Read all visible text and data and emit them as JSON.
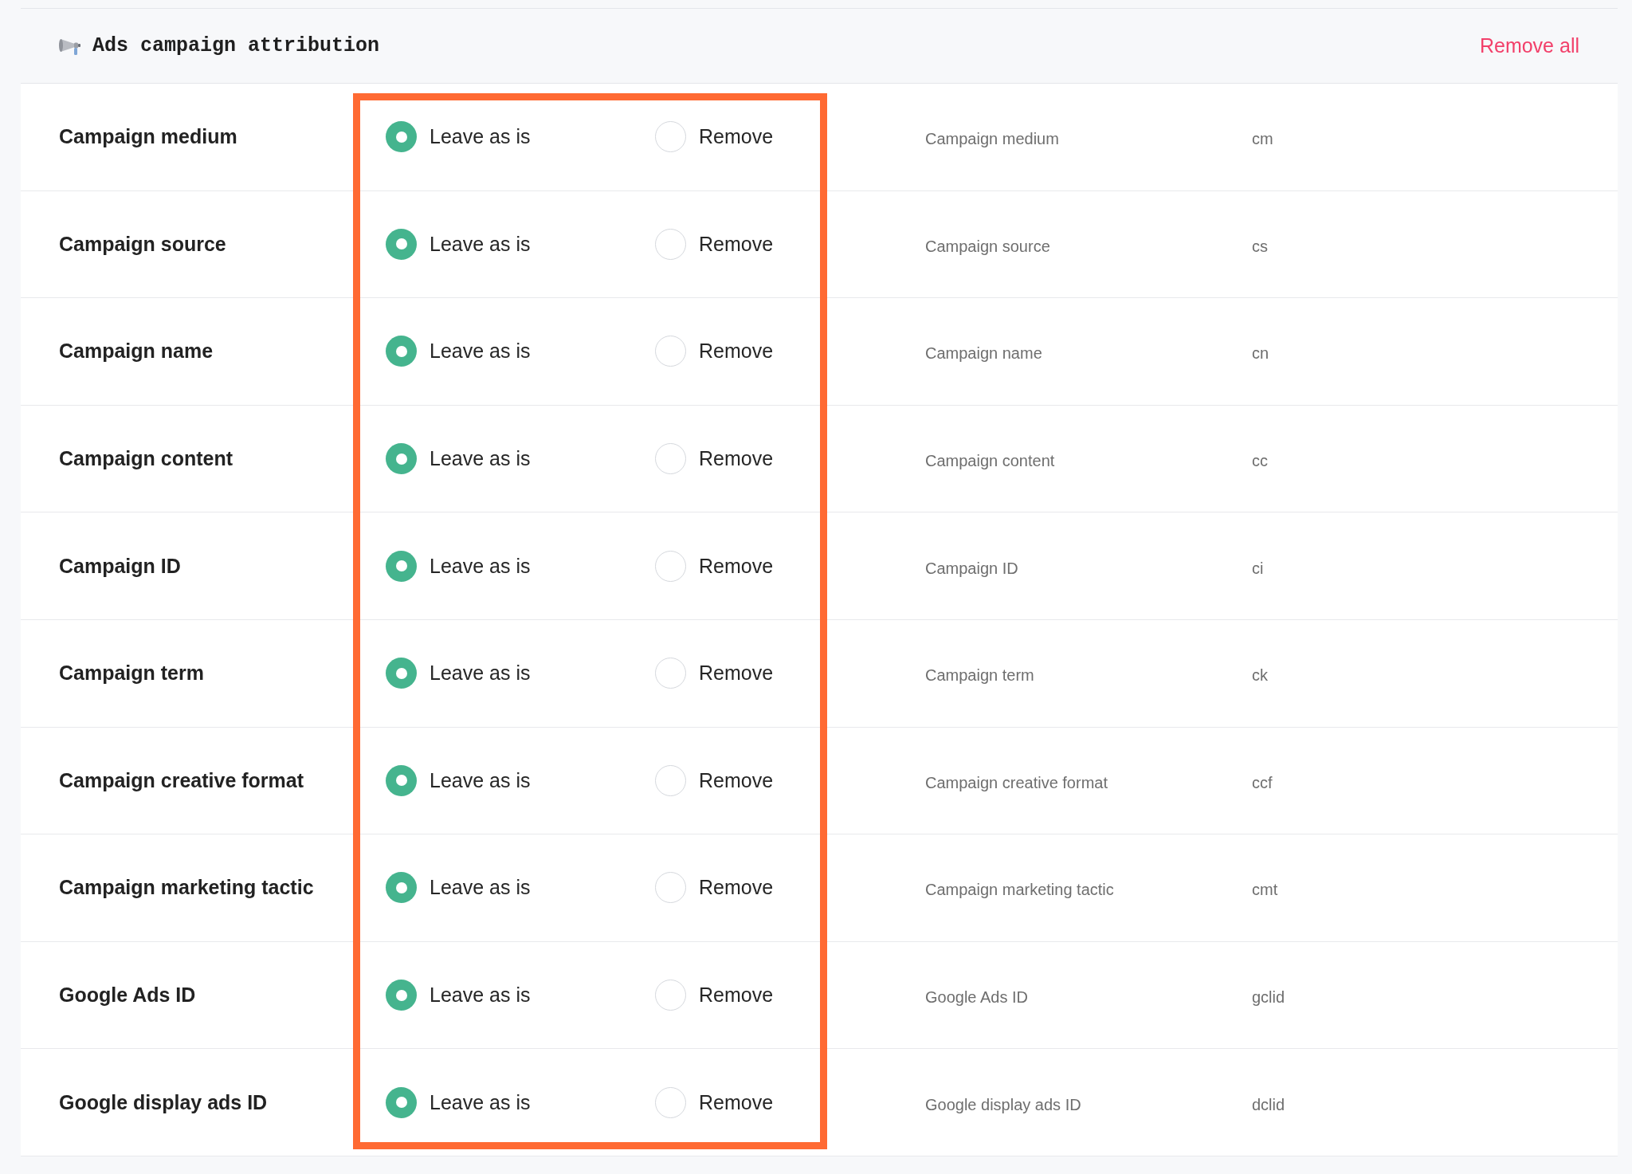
{
  "section": {
    "title": "Ads campaign attribution",
    "action": "Remove all"
  },
  "options_highlighted": true,
  "rows": [
    {
      "label": "Campaign medium",
      "options": [
        {
          "label": "Leave as is",
          "selected": true
        },
        {
          "label": "Remove",
          "selected": false
        }
      ],
      "column_3": "Campaign medium",
      "column_4": "cm"
    },
    {
      "label": "Campaign source",
      "options": [
        {
          "label": "Leave as is",
          "selected": true
        },
        {
          "label": "Remove",
          "selected": false
        }
      ],
      "column_3": "Campaign source",
      "column_4": "cs"
    },
    {
      "label": "Campaign name",
      "options": [
        {
          "label": "Leave as is",
          "selected": true
        },
        {
          "label": "Remove",
          "selected": false
        }
      ],
      "column_3": "Campaign name",
      "column_4": "cn"
    },
    {
      "label": "Campaign content",
      "options": [
        {
          "label": "Leave as is",
          "selected": true
        },
        {
          "label": "Remove",
          "selected": false
        }
      ],
      "column_3": "Campaign content",
      "column_4": "cc"
    },
    {
      "label": "Campaign ID",
      "options": [
        {
          "label": "Leave as is",
          "selected": true
        },
        {
          "label": "Remove",
          "selected": false
        }
      ],
      "column_3": "Campaign ID",
      "column_4": "ci"
    },
    {
      "label": "Campaign term",
      "options": [
        {
          "label": "Leave as is",
          "selected": true
        },
        {
          "label": "Remove",
          "selected": false
        }
      ],
      "column_3": "Campaign term",
      "column_4": "ck"
    },
    {
      "label": "Campaign creative format",
      "options": [
        {
          "label": "Leave as is",
          "selected": true
        },
        {
          "label": "Remove",
          "selected": false
        }
      ],
      "column_3": "Campaign creative format",
      "column_4": "ccf"
    },
    {
      "label": "Campaign marketing tactic",
      "options": [
        {
          "label": "Leave as is",
          "selected": true
        },
        {
          "label": "Remove",
          "selected": false
        }
      ],
      "column_3": "Campaign marketing tactic",
      "column_4": "cmt"
    },
    {
      "label": "Google Ads ID",
      "options": [
        {
          "label": "Leave as is",
          "selected": true
        },
        {
          "label": "Remove",
          "selected": false
        }
      ],
      "column_3": "Google Ads ID",
      "column_4": "gclid"
    },
    {
      "label": "Google display ads ID",
      "options": [
        {
          "label": "Leave as is",
          "selected": true
        },
        {
          "label": "Remove",
          "selected": false
        }
      ],
      "column_3": "Google display ads ID",
      "column_4": "dclid"
    }
  ]
}
